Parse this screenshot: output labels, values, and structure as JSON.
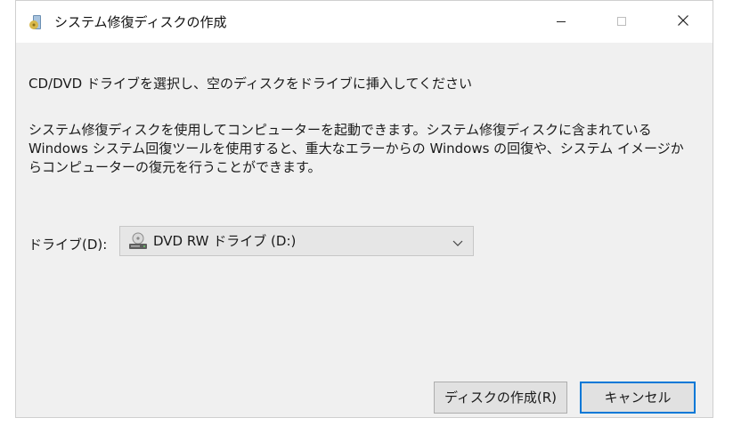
{
  "window": {
    "title": "システム修復ディスクの作成",
    "icon": "disc-icon",
    "controls": {
      "minimize": "minimize-icon",
      "maximize": "maximize-icon",
      "close": "close-icon"
    }
  },
  "instruction": "CD/DVD ドライブを選択し、空のディスクをドライブに挿入してください",
  "description": [
    "システム修復ディスクを使用してコンピューターを起動できます。システム修復ディスクに含まれている",
    "Windows システム回復ツールを使用すると、重大なエラーからの Windows の回復や、システム イメージか",
    "らコンピューターの復元を行うことができます。"
  ],
  "drive": {
    "label": "ドライブ(D):",
    "selected": "DVD RW ドライブ (D:)",
    "icon": "dvd-drive-icon"
  },
  "buttons": {
    "create": "ディスクの作成(R)",
    "cancel": "キャンセル"
  },
  "colors": {
    "dialog_bg": "#f0f0f0",
    "titlebar_bg": "#ffffff",
    "focus_border": "#0078d7"
  }
}
